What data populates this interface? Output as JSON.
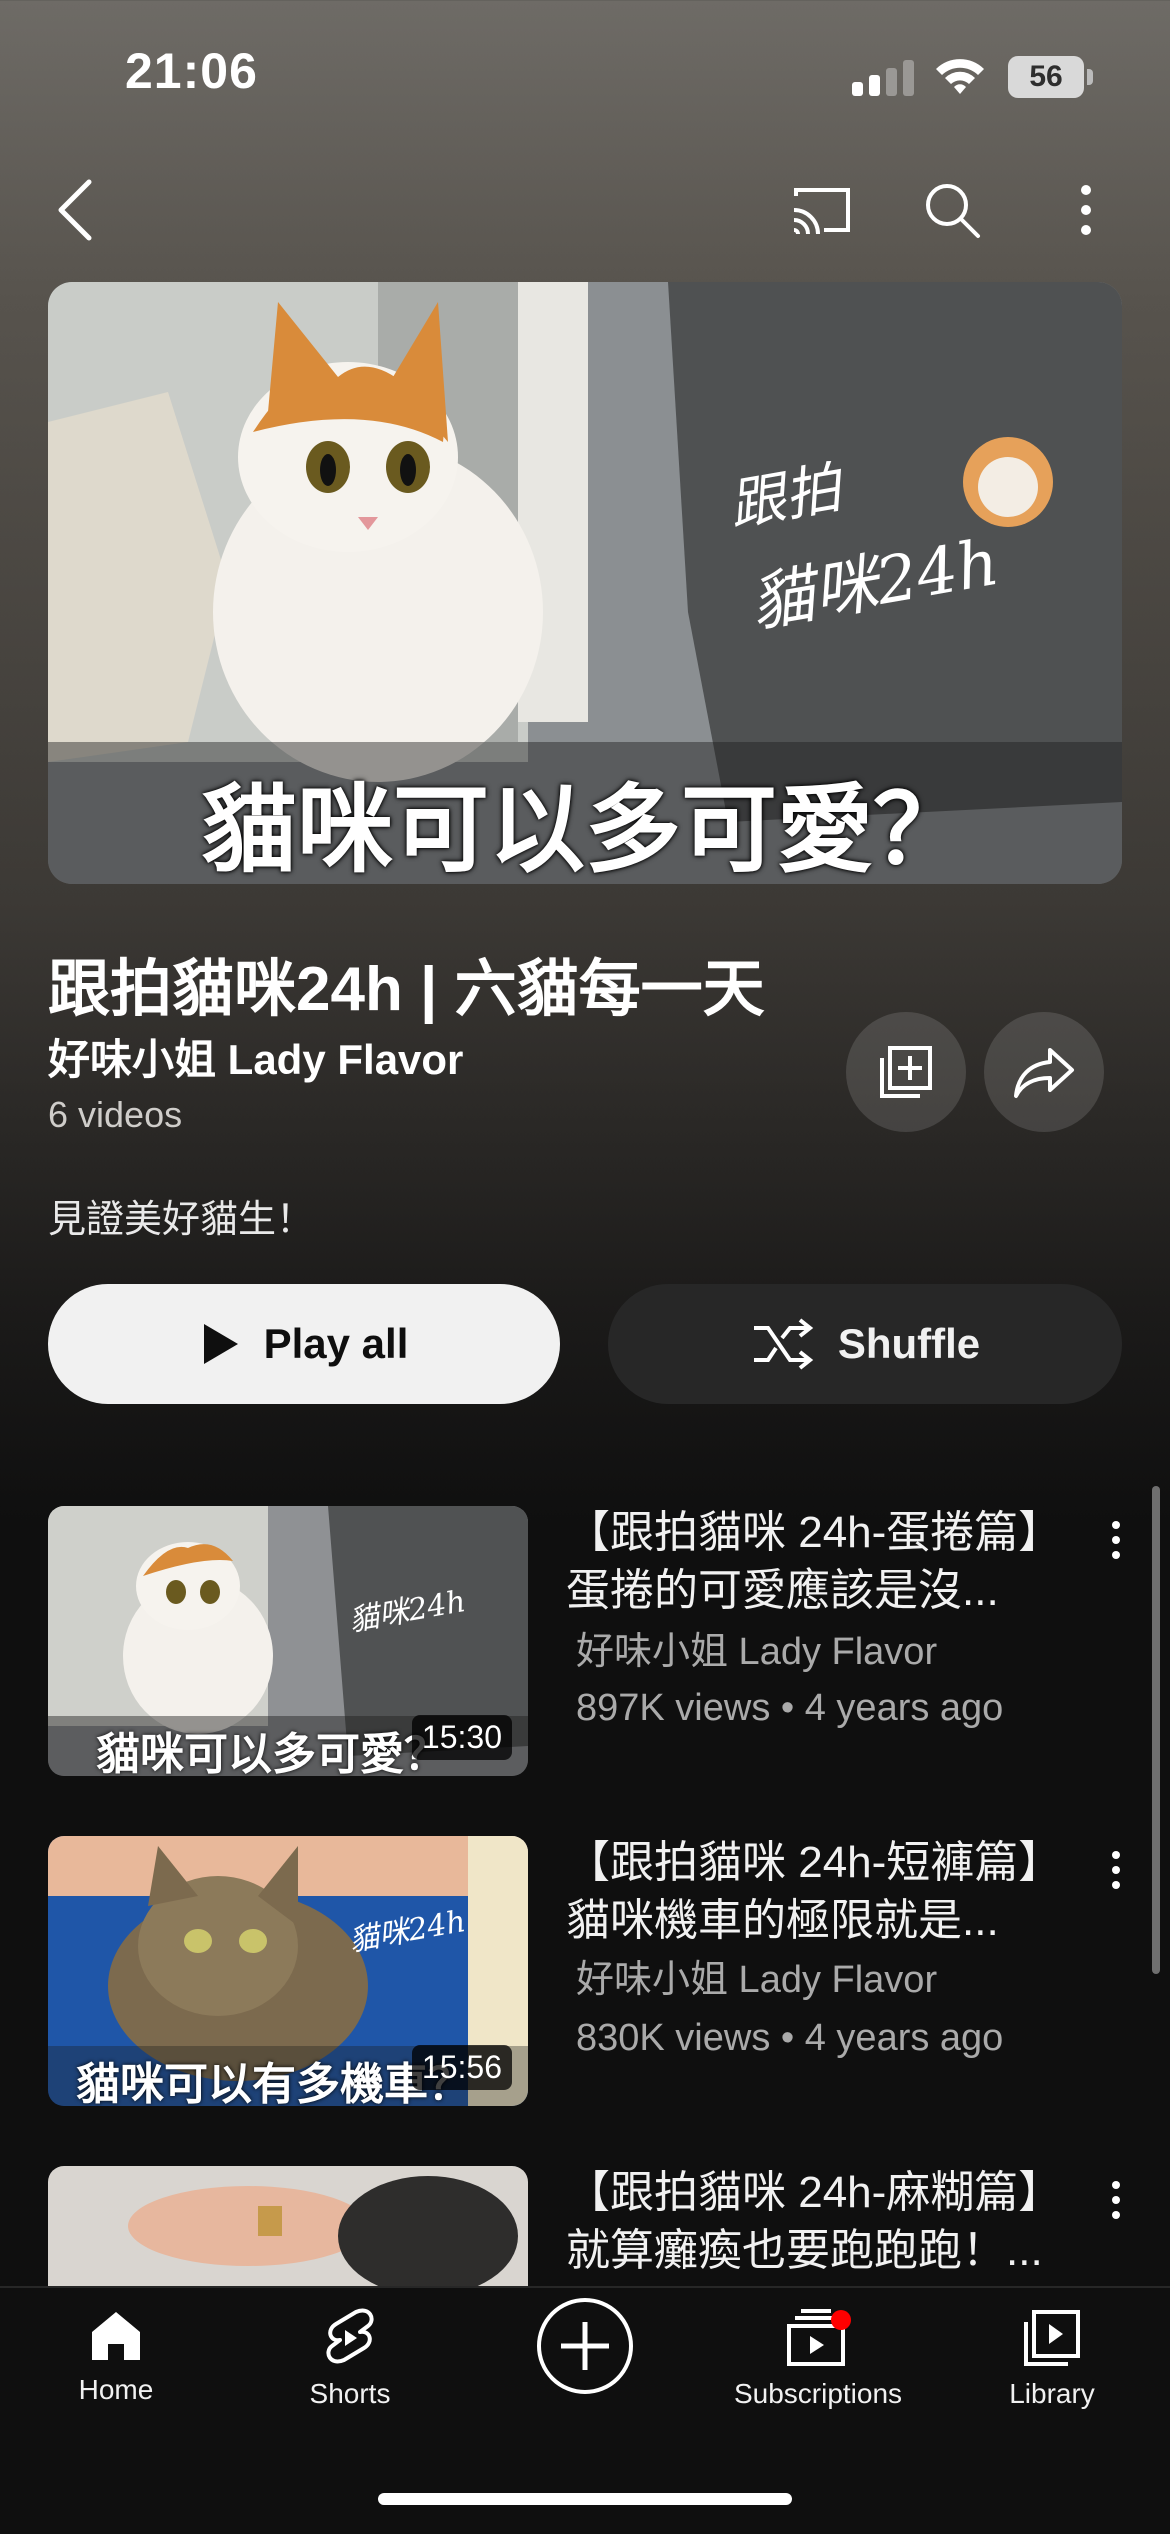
{
  "status_bar": {
    "time": "21:06",
    "battery": "56"
  },
  "top_nav": {
    "icons": [
      "back-icon",
      "cast-icon",
      "search-icon",
      "more-vert-icon"
    ]
  },
  "hero": {
    "thumbnail_caption": "貓咪可以多可愛？",
    "thumbnail_logo_line1": "跟拍",
    "thumbnail_logo_line2": "貓咪24h"
  },
  "playlist": {
    "title": "跟拍貓咪24h | 六貓每一天",
    "channel": "好味小姐 Lady Flavor",
    "video_count": "6 videos",
    "description": "見證美好貓生！"
  },
  "actions": {
    "play_all": "Play all",
    "shuffle": "Shuffle"
  },
  "videos": [
    {
      "title_line1": "【跟拍貓咪 24h-蛋捲篇】",
      "title_line2": "蛋捲的可愛應該是沒...",
      "channel": "好味小姐 Lady Flavor",
      "meta": "897K views • 4 years ago",
      "duration": "15:30",
      "thumb_caption": "貓咪可以多可愛？"
    },
    {
      "title_line1": "【跟拍貓咪 24h-短褲篇】",
      "title_line2": "貓咪機車的極限就是...",
      "channel": "好味小姐 Lady Flavor",
      "meta": "830K views • 4 years ago",
      "duration": "15:56",
      "thumb_caption": "貓咪可以有多機車？"
    },
    {
      "title_line1": "【跟拍貓咪 24h-麻糊篇】",
      "title_line2": "就算癱瘓也要跑跑跑！..."
    }
  ],
  "bottom_nav": {
    "home": "Home",
    "shorts": "Shorts",
    "subscriptions": "Subscriptions",
    "library": "Library"
  },
  "colors": {
    "accent_red": "#ff0000",
    "background": "#0f0f0f",
    "play_all_bg": "#f1f1f1"
  }
}
